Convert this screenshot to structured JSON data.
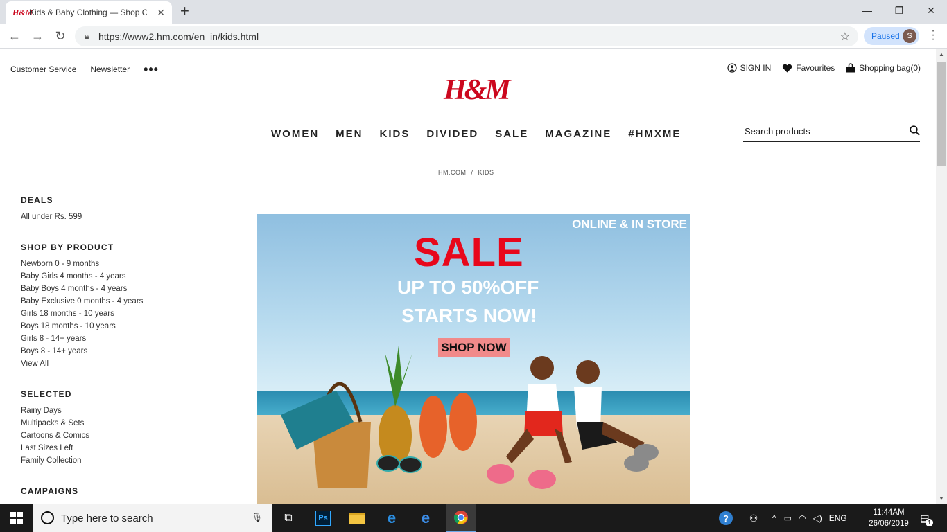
{
  "browser": {
    "tab_title": "Kids & Baby Clothing — Shop Or",
    "tab_favicon": "H&M",
    "url": "https://www2.hm.com/en_in/kids.html",
    "profile_status": "Paused",
    "profile_initial": "S"
  },
  "header": {
    "utility_left": [
      "Customer Service",
      "Newsletter"
    ],
    "sign_in": "SIGN IN",
    "favourites": "Favourites",
    "shopping_bag": "Shopping bag(0)",
    "logo": "H&M",
    "nav": [
      "WOMEN",
      "MEN",
      "KIDS",
      "DIVIDED",
      "SALE",
      "MAGAZINE",
      "#HMXME"
    ],
    "search_placeholder": "Search products"
  },
  "breadcrumb": [
    "HM.COM",
    "KIDS"
  ],
  "sidebar": {
    "deals": {
      "title": "DEALS",
      "links": [
        "All under Rs. 599"
      ]
    },
    "shop_by_product": {
      "title": "SHOP BY PRODUCT",
      "links": [
        "Newborn 0 - 9 months",
        "Baby Girls 4 months - 4 years",
        "Baby Boys 4 months - 4 years",
        "Baby Exclusive 0 months - 4 years",
        "Girls 18 months - 10 years",
        "Boys 18 months - 10 years",
        "Girls 8 - 14+ years",
        "Boys 8 - 14+ years",
        "View All"
      ]
    },
    "selected": {
      "title": "SELECTED",
      "links": [
        "Rainy Days",
        "Multipacks & Sets",
        "Cartoons & Comics",
        "Last Sizes Left",
        "Family Collection"
      ]
    },
    "campaigns": {
      "title": "CAMPAIGNS"
    }
  },
  "hero": {
    "badge": "ONLINE & IN STORE",
    "headline": "SALE",
    "line1": "UP TO 50%OFF",
    "line2": "STARTS NOW!",
    "cta": "SHOP NOW"
  },
  "taskbar": {
    "search_placeholder": "Type here to search",
    "language": "ENG",
    "time": "11:44AM",
    "date": "26/06/2019",
    "notification_count": "1"
  },
  "colors": {
    "brand_red": "#cc071e",
    "sale_red": "#e8071b",
    "cta_pink": "#f18a8a"
  }
}
